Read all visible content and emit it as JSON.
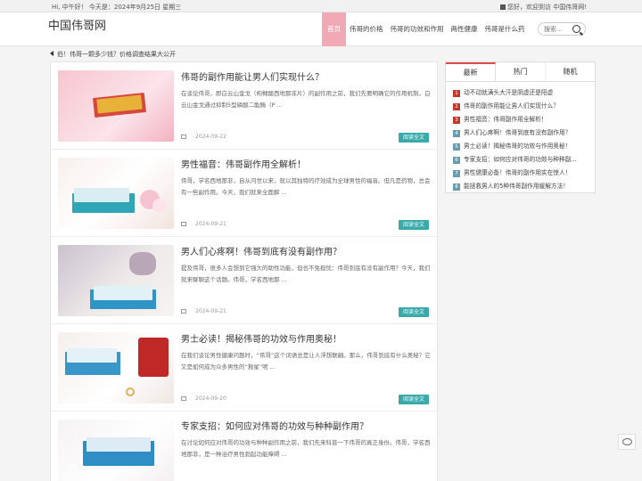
{
  "topbar": {
    "greeting": "Hi, 中午好！ 今天是：2024年9月25日 星期三",
    "welcome": "您好，欢迎到访 中国伟哥网!"
  },
  "header": {
    "logo": "中国伟哥网",
    "nav": [
      {
        "label": "首页",
        "active": true
      },
      {
        "label": "伟哥的价格"
      },
      {
        "label": "伟哥的功效和作用"
      },
      {
        "label": "两性健康"
      },
      {
        "label": "伟哥是什么药"
      }
    ],
    "search_placeholder": "搜索..."
  },
  "notice": "伯！伟哥一颗多少钱？价格调查结果大公开",
  "posts": [
    {
      "title": "伟哥的副作用能让男人们实现什么？",
      "excerpt": "在谈论伟哥，即白云山金戈（枸橼酸西地那非片）的副作用之前，我们先要明确它的作用机制。白云山金戈通过抑制5型磷酸二酯酶（P ...",
      "date": "2024-09-22",
      "read_more": "阅读全文",
      "image_icon": "medicine-box-red-image"
    },
    {
      "title": "男性福音：伟哥副作用全解析！",
      "excerpt": "伟哥，学名西地那非，自从问世以来，就以其独特的疗效成为全球男性的福音。但凡是药物，总会有一些副作用。今天，我们就来全面解 ...",
      "date": "2024-09-21",
      "read_more": "阅读全文",
      "image_icon": "medicine-box-flowers-image"
    },
    {
      "title": "男人们心疼啊！伟哥到底有没有副作用？",
      "excerpt": "提及伟哥，很多人会想到它强大的助性功能，但也不免担忧：伟哥到底有没有副作用？今天，我们就来聊聊这个话题。伟哥，学名西地那 ...",
      "date": "2024-09-21",
      "read_more": "阅读全文",
      "image_icon": "medicine-box-couple-image"
    },
    {
      "title": "男士必读！揭秘伟哥的功效与作用奥秘！",
      "excerpt": "在我们谈论男性健康问题时，“伟哥”这个词语总是让人浮想联翩。那么，伟哥到底有什么奥秘？它又是如何成为众多男性的“救星”呢 ...",
      "date": "2024-09-20",
      "read_more": "阅读全文",
      "image_icon": "medicine-box-rings-image"
    },
    {
      "title": "专家支招：如何应对伟哥的功效与种种副作用？",
      "excerpt": "在讨论如何应对伟哥的功效与种种副作用之前，我们先来科普一下伟哥的真正身份。伟哥，学名西地那非，是一种治疗男性勃起功能障碍 ...",
      "date": "2024-09-20",
      "read_more": "阅读全文",
      "image_icon": "medicine-box-blue-image"
    }
  ],
  "sidebar": {
    "tabs": [
      "最新",
      "热门",
      "随机"
    ],
    "items": [
      {
        "num": "1",
        "text": "动不动就满头大汗是阴虚还是阳虚"
      },
      {
        "num": "2",
        "text": "伟哥的副作用能让男人们实现什么？"
      },
      {
        "num": "3",
        "text": "男性福音：伟哥副作用全解析！"
      },
      {
        "num": "4",
        "text": "男人们心疼啊！伟哥到底有没有副作用？"
      },
      {
        "num": "5",
        "text": "男士必读！揭秘伟哥的功效与作用奥秘！"
      },
      {
        "num": "6",
        "text": "专家支招：如何应对伟哥的功效与种种副..."
      },
      {
        "num": "7",
        "text": "男性健康必备！伟哥的副作用实在惊人！"
      },
      {
        "num": "8",
        "text": "能拯救男人的5种伟哥副作用缓解方法！"
      }
    ]
  },
  "colors": {
    "accent_pink": "#f2a9b6",
    "read_more_teal": "#39a9a9",
    "rank_red": "#c0392b",
    "rank_blue": "#6b9bb0",
    "tab_active": "#e04a4a"
  }
}
